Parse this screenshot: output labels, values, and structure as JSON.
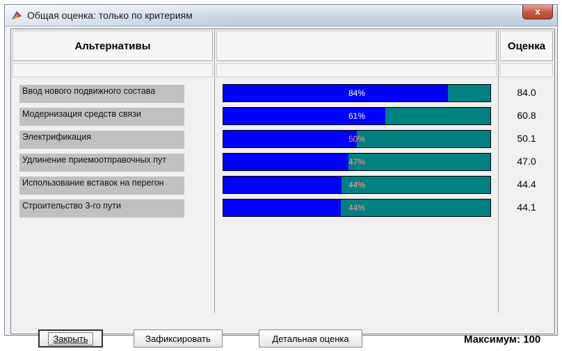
{
  "window": {
    "title": "Общая оценка: только по критериям",
    "close_label": "x"
  },
  "columns": {
    "alternatives": "Альтернативы",
    "score": "Оценка"
  },
  "rows": [
    {
      "label": "Ввод нового подвижного состава",
      "percent_text": "84%",
      "fill": 0.84,
      "score": "84.0"
    },
    {
      "label": "Модернизация средств связи",
      "percent_text": "61%",
      "fill": 0.608,
      "score": "60.8"
    },
    {
      "label": "Электрификация",
      "percent_text": "50%",
      "fill": 0.501,
      "score": "50.1"
    },
    {
      "label": "Удлинение приемоотправочных пут",
      "percent_text": "47%",
      "fill": 0.47,
      "score": "47.0"
    },
    {
      "label": "Использование вставок на перегон",
      "percent_text": "44%",
      "fill": 0.444,
      "score": "44.4"
    },
    {
      "label": "Строительство 3-го пути",
      "percent_text": "44%",
      "fill": 0.441,
      "score": "44.1"
    }
  ],
  "buttons": {
    "close": "Закрыть",
    "fix": "Зафиксировать",
    "detail": "Детальная оценка"
  },
  "maximum_text": "Максимум: 100",
  "colors": {
    "bar_fill": "#0000ff",
    "bar_track": "#008080"
  },
  "icons": {
    "app": "app-icon",
    "close": "close-icon"
  }
}
